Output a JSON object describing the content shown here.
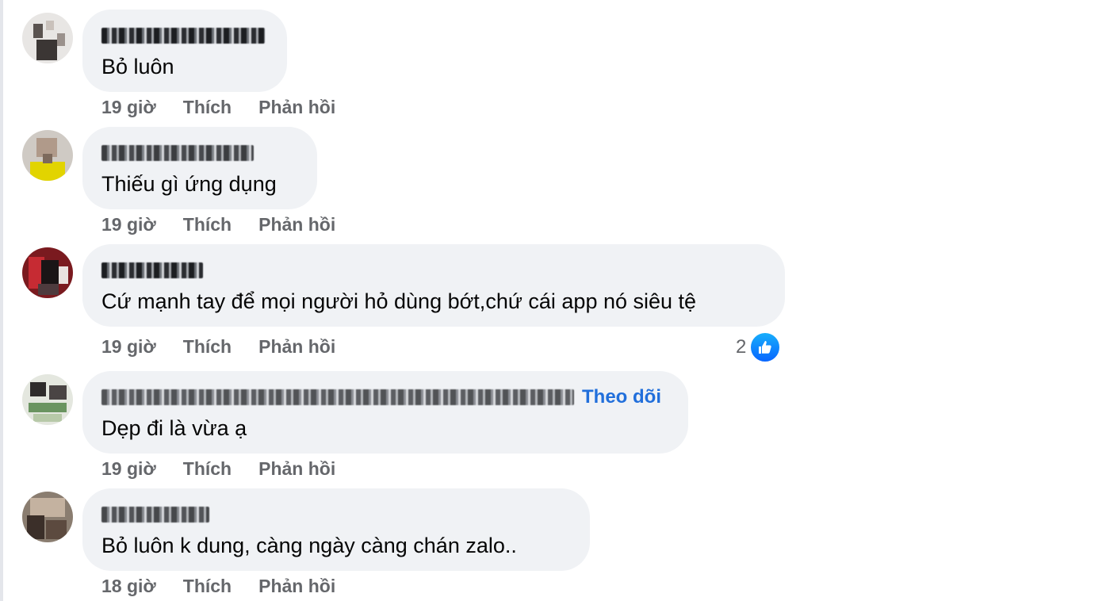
{
  "comments": [
    {
      "author_visible_suffix": "",
      "text": "Bỏ luôn",
      "time": "19 giờ",
      "like_label": "Thích",
      "reply_label": "Phản hồi"
    },
    {
      "text": "Thiếu gì ứng dụng",
      "time": "19 giờ",
      "like_label": "Thích",
      "reply_label": "Phản hồi"
    },
    {
      "text": "Cứ mạnh tay để mọi người hỏ dùng bớt,chứ cái app nó siêu tệ",
      "time": "19 giờ",
      "like_label": "Thích",
      "reply_label": "Phản hồi",
      "reaction_count": "2",
      "reaction_icon": "like-icon"
    },
    {
      "text": "Dẹp đi là vừa ạ",
      "time": "19 giờ",
      "like_label": "Thích",
      "reply_label": "Phản hồi",
      "follow_label": "Theo dõi"
    },
    {
      "text": "Bỏ luôn k dung, càng ngày càng chán zalo..",
      "time": "18 giờ",
      "like_label": "Thích",
      "reply_label": "Phản hồi"
    }
  ],
  "colors": {
    "bubble": "#f0f2f5",
    "meta_text": "#65676b",
    "follow_link": "#216fdb",
    "like_blue": "#0866ff"
  }
}
